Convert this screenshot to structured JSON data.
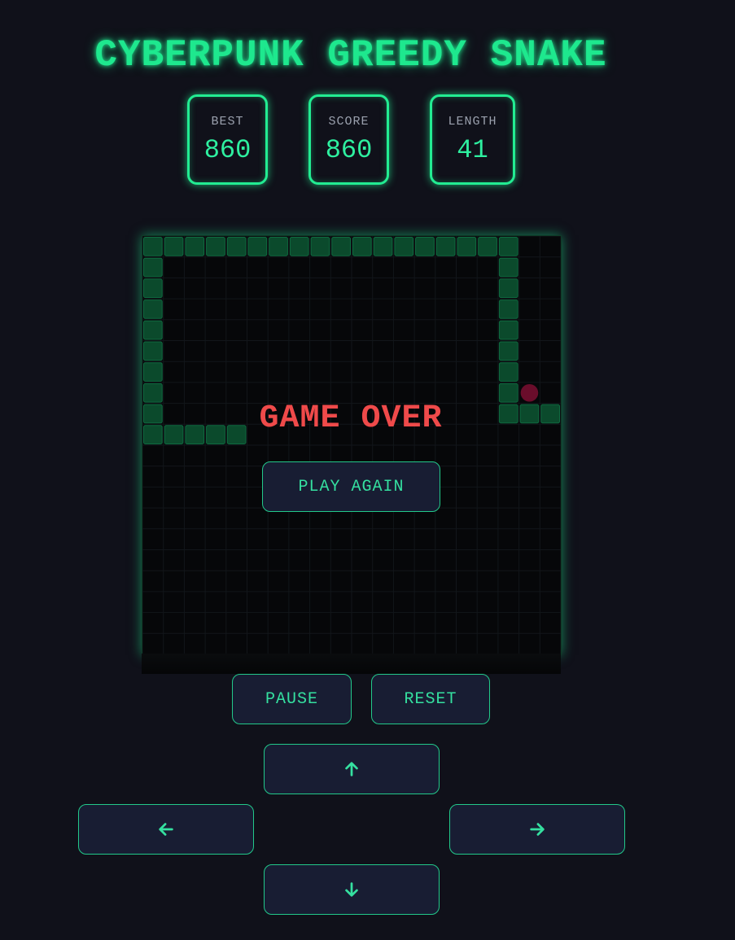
{
  "title": "CYBERPUNK GREEDY SNAKE",
  "stats": [
    {
      "label": "BEST",
      "value": "860"
    },
    {
      "label": "SCORE",
      "value": "860"
    },
    {
      "label": "LENGTH",
      "value": "41"
    }
  ],
  "board": {
    "cols": 20,
    "rows": 20,
    "snake_cells": [
      [
        0,
        0
      ],
      [
        1,
        0
      ],
      [
        2,
        0
      ],
      [
        3,
        0
      ],
      [
        4,
        0
      ],
      [
        5,
        0
      ],
      [
        6,
        0
      ],
      [
        7,
        0
      ],
      [
        8,
        0
      ],
      [
        9,
        0
      ],
      [
        10,
        0
      ],
      [
        11,
        0
      ],
      [
        12,
        0
      ],
      [
        13,
        0
      ],
      [
        14,
        0
      ],
      [
        15,
        0
      ],
      [
        16,
        0
      ],
      [
        17,
        0
      ],
      [
        17,
        1
      ],
      [
        17,
        2
      ],
      [
        17,
        3
      ],
      [
        17,
        4
      ],
      [
        17,
        5
      ],
      [
        17,
        6
      ],
      [
        17,
        7
      ],
      [
        17,
        8
      ],
      [
        18,
        8
      ],
      [
        19,
        8
      ],
      [
        0,
        1
      ],
      [
        0,
        2
      ],
      [
        0,
        3
      ],
      [
        0,
        4
      ],
      [
        0,
        5
      ],
      [
        0,
        6
      ],
      [
        0,
        7
      ],
      [
        0,
        8
      ],
      [
        0,
        9
      ],
      [
        1,
        9
      ],
      [
        2,
        9
      ],
      [
        3,
        9
      ],
      [
        4,
        9
      ]
    ],
    "food_cell": [
      18,
      7
    ],
    "colors": {
      "snake": "#0b4a2c",
      "snake_border": "#0f6a40",
      "food": "#6a0d2b",
      "grid": "#12161a",
      "background": "#060709"
    }
  },
  "overlay": {
    "message": "GAME OVER",
    "play_again": "PLAY AGAIN"
  },
  "controls": {
    "pause": "PAUSE",
    "reset": "RESET",
    "up_icon": "arrow-up-icon",
    "left_icon": "arrow-left-icon",
    "right_icon": "arrow-right-icon",
    "down_icon": "arrow-down-icon"
  },
  "colors": {
    "accent": "#1ee88e",
    "danger": "#ef4a4a",
    "page_bg": "#10111a",
    "button_bg": "#181d33"
  }
}
